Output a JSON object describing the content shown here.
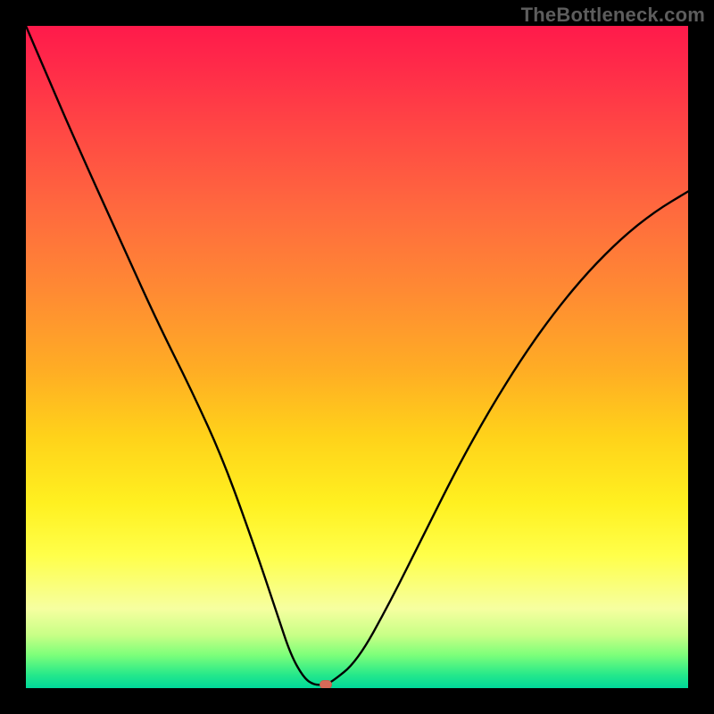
{
  "watermark": "TheBottleneck.com",
  "colors": {
    "border": "#000000",
    "curve": "#000000",
    "marker": "#d86a58"
  },
  "chart_data": {
    "type": "line",
    "title": "",
    "xlabel": "",
    "ylabel": "",
    "xlim": [
      0,
      100
    ],
    "ylim": [
      0,
      100
    ],
    "background_gradient": {
      "direction": "vertical",
      "stops": [
        {
          "pos": 0,
          "color": "#ff1a4b"
        },
        {
          "pos": 28,
          "color": "#ff6a3e"
        },
        {
          "pos": 52,
          "color": "#ffad24"
        },
        {
          "pos": 72,
          "color": "#fff020"
        },
        {
          "pos": 88,
          "color": "#f6ffa0"
        },
        {
          "pos": 100,
          "color": "#00d89a"
        }
      ]
    },
    "series": [
      {
        "name": "bottleneck-curve",
        "x": [
          0,
          3,
          6,
          10,
          15,
          20,
          25,
          30,
          35,
          38,
          40,
          42,
          43.5,
          45,
          46,
          50,
          55,
          60,
          65,
          70,
          75,
          80,
          85,
          90,
          95,
          100
        ],
        "y": [
          100,
          93,
          86,
          77,
          66,
          55,
          45,
          34,
          20,
          11,
          5,
          1.5,
          0.5,
          0.5,
          0.8,
          4,
          13,
          23,
          33,
          42,
          50,
          57,
          63,
          68,
          72,
          75
        ]
      }
    ],
    "marker": {
      "x": 45.3,
      "y": 0.5
    },
    "plateau": {
      "x_start": 43.5,
      "x_end": 45.5,
      "y": 0.5
    }
  }
}
